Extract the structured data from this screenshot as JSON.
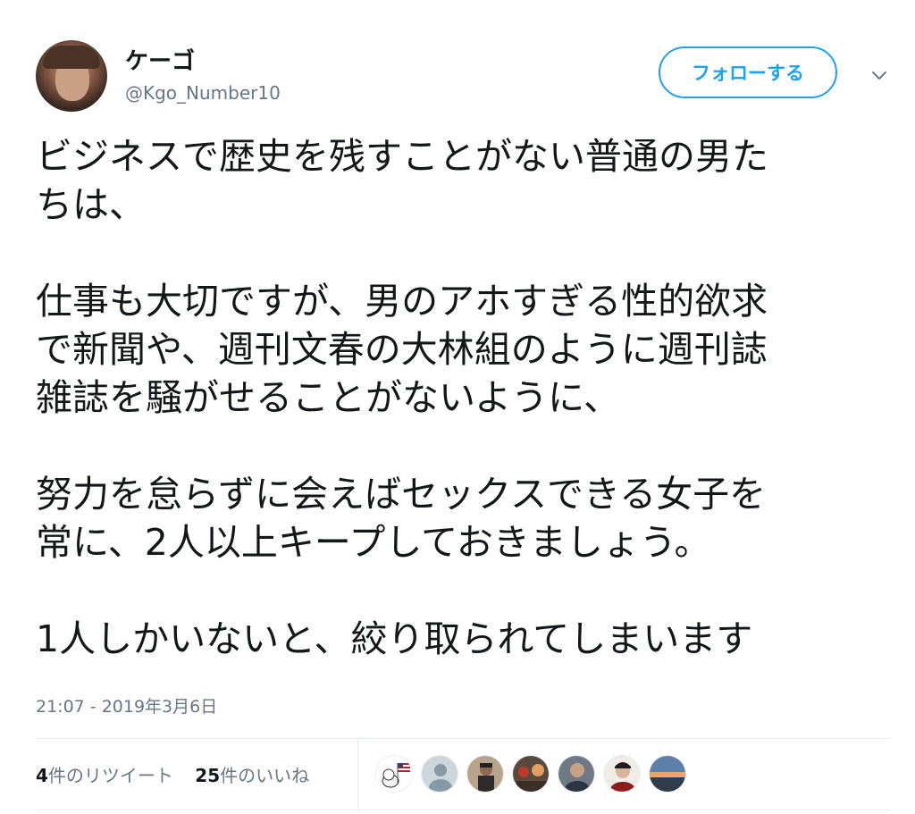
{
  "user": {
    "display_name": "ケーゴ",
    "handle": "@Kgo_Number10"
  },
  "actions": {
    "follow_label": "フォローする",
    "menu_icon": "chevron-down-icon"
  },
  "tweet": {
    "paragraphs": [
      [
        "ビジネスで歴史を残すことがない普通の男た",
        "ちは、"
      ],
      [
        "仕事も大切ですが、男のアホすぎる性的欲求",
        "で新聞や、週刊文春の大林組のように週刊誌",
        "雑誌を騒がせることがないように、"
      ],
      [
        "努力を怠らずに会えばセックスできる女子を",
        "常に、2人以上キープしておきましょう。"
      ],
      [
        "1人しかいないと、絞り取られてしまいます"
      ]
    ],
    "timestamp": "21:07 - 2019年3月6日"
  },
  "stats": {
    "retweets_count": "4",
    "retweets_label": "件のリツイート",
    "likes_count": "25",
    "likes_label": "件のいいね"
  },
  "likers": [
    {
      "name": "liker-avatar-1",
      "kind": "cartoon-flag"
    },
    {
      "name": "liker-avatar-2",
      "kind": "default"
    },
    {
      "name": "liker-avatar-3",
      "kind": "photo"
    },
    {
      "name": "liker-avatar-4",
      "kind": "photo"
    },
    {
      "name": "liker-avatar-5",
      "kind": "photo"
    },
    {
      "name": "liker-avatar-6",
      "kind": "photo"
    },
    {
      "name": "liker-avatar-7",
      "kind": "landscape"
    }
  ],
  "colors": {
    "accent": "#1da1f2",
    "text": "#14171a",
    "secondary": "#657786",
    "divider": "#e6ecf0"
  }
}
